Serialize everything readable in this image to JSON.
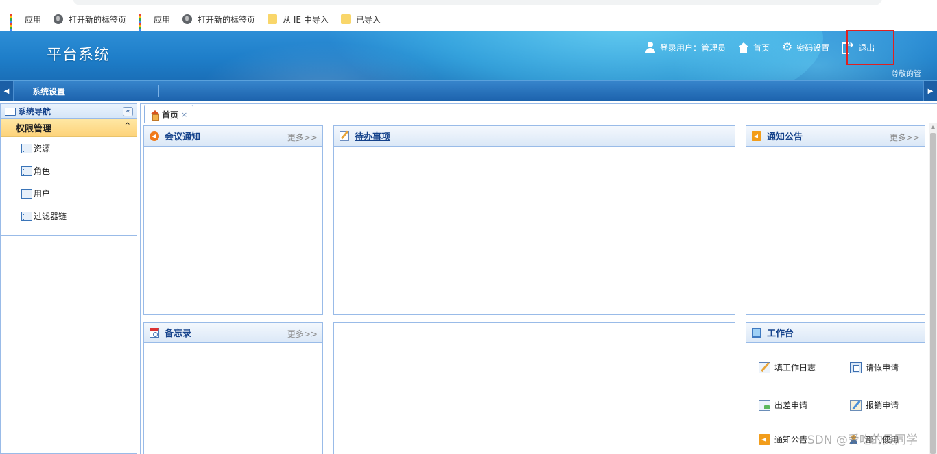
{
  "bookmarks": [
    {
      "label": "应用",
      "icon": "apps-icon"
    },
    {
      "label": "打开新的标签页",
      "icon": "globe-icon"
    },
    {
      "label": "应用",
      "icon": "apps-icon"
    },
    {
      "label": "打开新的标签页",
      "icon": "globe-icon"
    },
    {
      "label": "从 IE 中导入",
      "icon": "folder-icon"
    },
    {
      "label": "已导入",
      "icon": "folder-icon"
    }
  ],
  "header": {
    "title": "平台系统",
    "user_label": "登录用户：管理员",
    "home_label": "首页",
    "password_label": "密码设置",
    "logout_label": "退出",
    "welcome": "尊敬的管"
  },
  "menubar": {
    "active_item": "系统设置",
    "left_arrow": "◀",
    "right_arrow": "▶"
  },
  "sidebar": {
    "title": "系统导航",
    "collapse_glyph": "«",
    "group": "权限管理",
    "group_chevron": "^",
    "items": [
      {
        "label": "资源"
      },
      {
        "label": "角色"
      },
      {
        "label": "用户"
      },
      {
        "label": "过滤器链"
      }
    ]
  },
  "tabs": {
    "home_label": "首页",
    "close_glyph": "×"
  },
  "panels": {
    "meeting": {
      "title": "会议通知",
      "more": "更多>>"
    },
    "todo": {
      "title": "待办事项"
    },
    "notice": {
      "title": "通知公告",
      "more": "更多>>"
    },
    "memo": {
      "title": "备忘录",
      "more": "更多>>"
    },
    "workbench": {
      "title": "工作台",
      "items": [
        {
          "label": "填工作日志"
        },
        {
          "label": "请假申请"
        },
        {
          "label": "出差申请"
        },
        {
          "label": "报销申请"
        },
        {
          "label": "通知公告"
        },
        {
          "label": "部门使用"
        }
      ]
    }
  },
  "watermark": "CSDN @爱吃的吴同学",
  "colors": {
    "header_blue": "#1e7ec9",
    "menubar_blue": "#1d63ad",
    "group_yellow": "#fdd37a",
    "highlight_red": "#e02020",
    "panel_title": "#15428b"
  }
}
